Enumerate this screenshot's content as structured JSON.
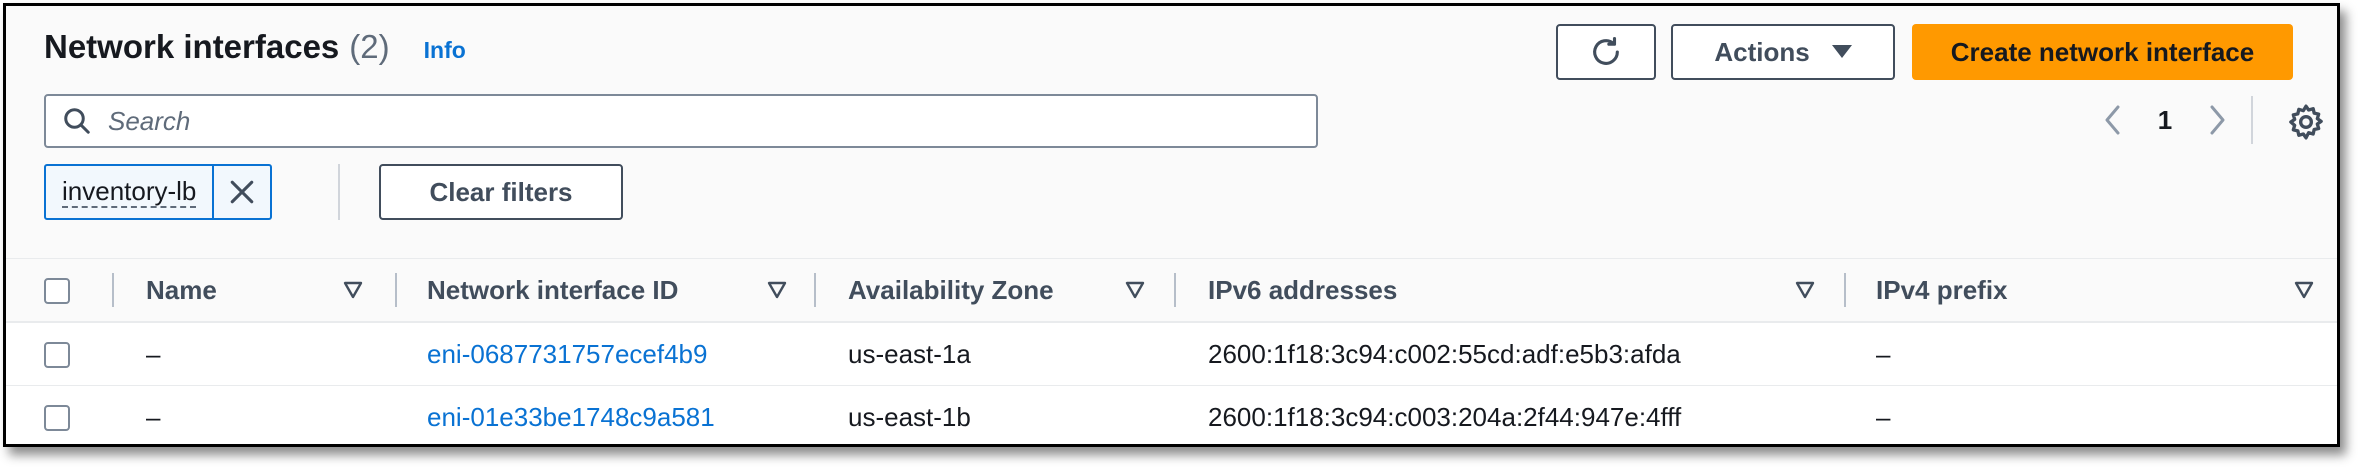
{
  "header": {
    "title": "Network interfaces",
    "count": "(2)",
    "info_label": "Info"
  },
  "toolbar": {
    "refresh_icon": "refresh-icon",
    "actions_label": "Actions",
    "create_label": "Create network interface",
    "accent_color": "#ff9900"
  },
  "search": {
    "placeholder": "Search",
    "value": ""
  },
  "pagination": {
    "current_page": "1"
  },
  "filters": {
    "tokens": [
      {
        "label": "inventory-lb"
      }
    ],
    "clear_label": "Clear filters"
  },
  "table": {
    "columns": [
      "Name",
      "Network interface ID",
      "Availability Zone",
      "IPv6 addresses",
      "IPv4 prefix"
    ],
    "rows": [
      {
        "name": "–",
        "eni_id": "eni-0687731757ecef4b9",
        "az": "us-east-1a",
        "ipv6": "2600:1f18:3c94:c002:55cd:adf:e5b3:afda",
        "ipv4_prefix": "–"
      },
      {
        "name": "–",
        "eni_id": "eni-01e33be1748c9a581",
        "az": "us-east-1b",
        "ipv6": "2600:1f18:3c94:c003:204a:2f44:947e:4fff",
        "ipv4_prefix": "–"
      }
    ]
  }
}
